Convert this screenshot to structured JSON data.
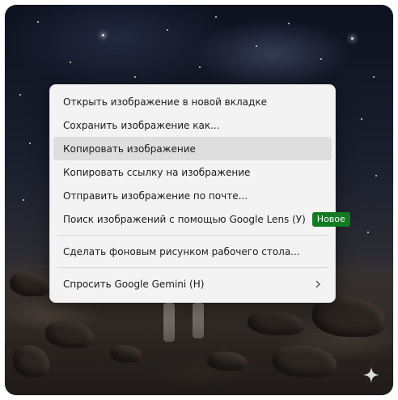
{
  "menu": {
    "items": [
      {
        "label": "Открыть изображение в новой вкладке"
      },
      {
        "label": "Сохранить изображение как..."
      },
      {
        "label": "Копировать изображение"
      },
      {
        "label": "Копировать ссылку на изображение"
      },
      {
        "label": "Отправить изображение по почте..."
      },
      {
        "label": "Поиск изображений с помощью Google Lens (У)",
        "badge": "Новое"
      },
      {
        "label": "Сделать фоновым рисунком рабочего стола..."
      },
      {
        "label": "Спросить Google Gemini (H)"
      }
    ],
    "hovered_index": 2,
    "colors": {
      "badge": "#117a22",
      "hover": "#dedede",
      "background": "#f3f3f3"
    }
  },
  "icons": {
    "submenu": "chevron-right-icon",
    "corner": "gemini-sparkle-icon"
  }
}
